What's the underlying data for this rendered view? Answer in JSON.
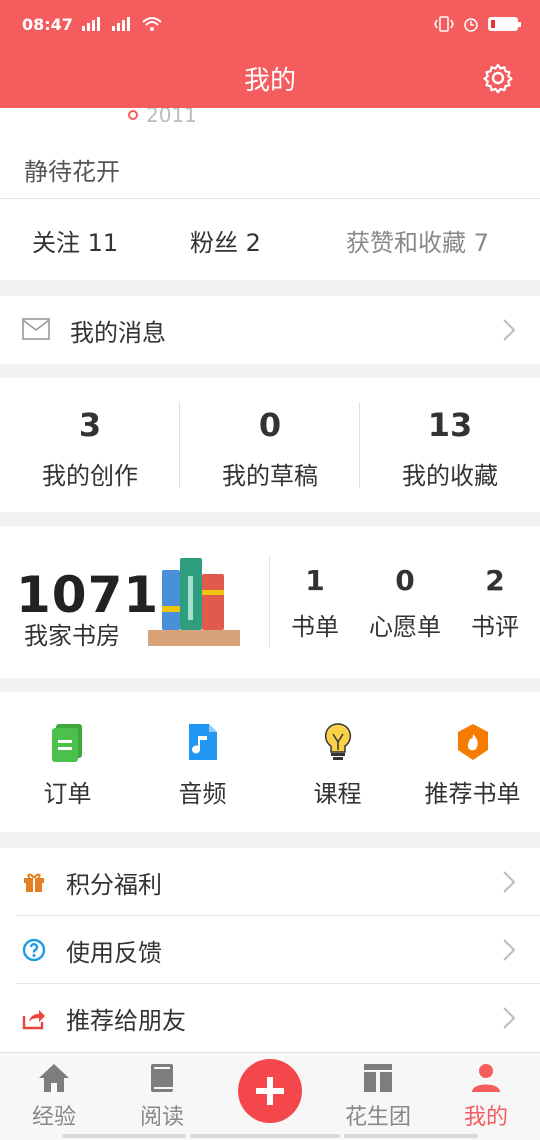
{
  "status": {
    "time": "08:47",
    "sig1": "4G",
    "sig2": "2G"
  },
  "header": {
    "title": "我的"
  },
  "profile": {
    "year": "2011",
    "name": "静待花开",
    "follow": "关注 11",
    "fans": "粉丝 2",
    "likes": "获赞和收藏 7"
  },
  "messages": {
    "label": "我的消息"
  },
  "works": [
    {
      "num": "3",
      "label": "我的创作"
    },
    {
      "num": "0",
      "label": "我的草稿"
    },
    {
      "num": "13",
      "label": "我的收藏"
    }
  ],
  "bookroom": {
    "count": "1071",
    "label": "我家书房",
    "items": [
      {
        "num": "1",
        "label": "书单"
      },
      {
        "num": "0",
        "label": "心愿单"
      },
      {
        "num": "2",
        "label": "书评"
      }
    ]
  },
  "services": [
    {
      "label": "订单",
      "icon": "order-icon"
    },
    {
      "label": "音频",
      "icon": "audio-icon"
    },
    {
      "label": "课程",
      "icon": "course-icon"
    },
    {
      "label": "推荐书单",
      "icon": "recommend-list-icon"
    }
  ],
  "menu": [
    {
      "label": "积分福利",
      "icon": "gift-icon"
    },
    {
      "label": "使用反馈",
      "icon": "help-icon"
    },
    {
      "label": "推荐给朋友",
      "icon": "share-icon"
    }
  ],
  "tabs": [
    {
      "label": "经验"
    },
    {
      "label": "阅读"
    },
    {
      "label": "花生团"
    },
    {
      "label": "我的"
    }
  ],
  "colors": {
    "brand": "#f45c5e",
    "active": "#f45c5e"
  }
}
